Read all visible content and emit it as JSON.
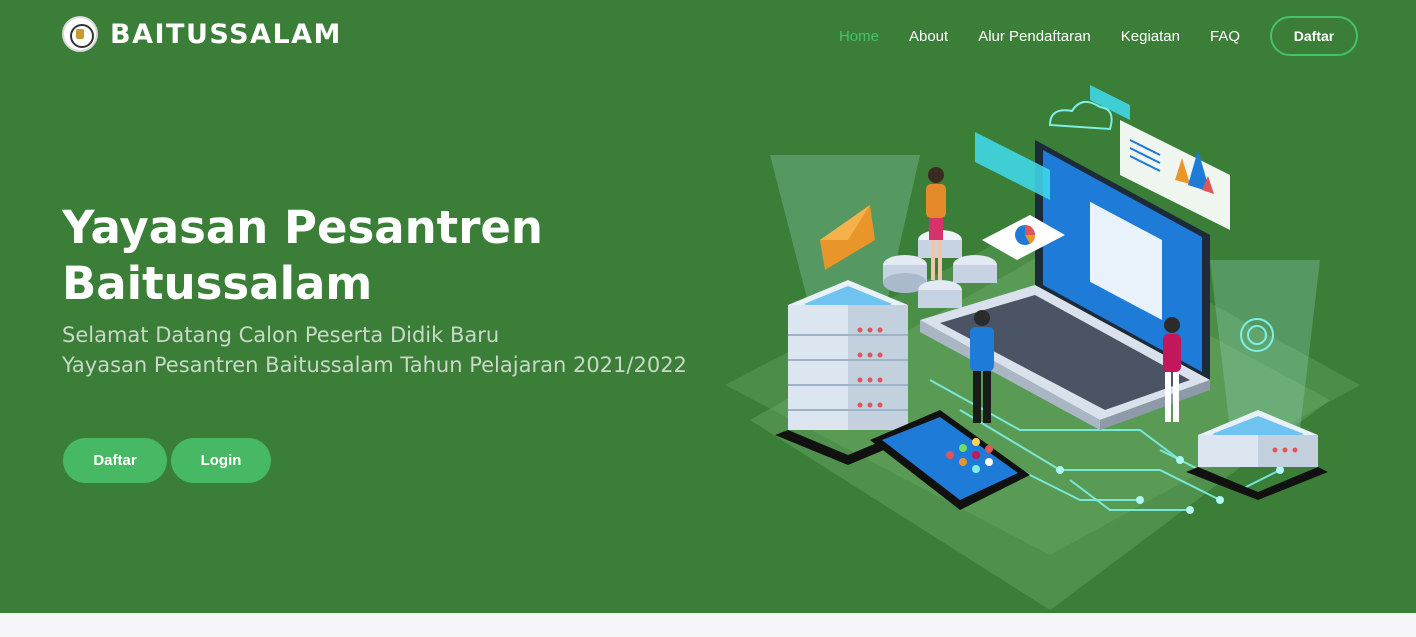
{
  "brand": {
    "name": "BAITUSSALAM",
    "logo_icon": "school-emblem-icon"
  },
  "nav": {
    "items": [
      {
        "label": "Home",
        "active": true
      },
      {
        "label": "About",
        "active": false
      },
      {
        "label": "Alur Pendaftaran",
        "active": false
      },
      {
        "label": "Kegiatan",
        "active": false
      },
      {
        "label": "FAQ",
        "active": false
      }
    ],
    "cta_label": "Daftar"
  },
  "hero": {
    "title_line1": "Yayasan Pesantren",
    "title_line2": "Baitussalam",
    "subtitle_line1": "Selamat Datang Calon Peserta Didik Baru",
    "subtitle_line2": "Yayasan Pesantren Baitussalam Tahun Pelajaran 2021/2022",
    "buttons": {
      "register_label": "Daftar",
      "login_label": "Login"
    },
    "illustration_icon": "isometric-online-learning-illustration"
  },
  "colors": {
    "hero_bg": "#3a7e38",
    "accent": "#47c16a",
    "button": "#47b864",
    "page_bg": "#f4f4f9"
  }
}
